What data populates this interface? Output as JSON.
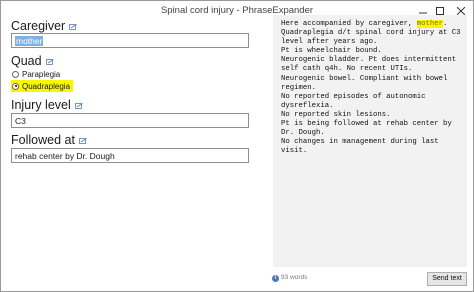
{
  "window": {
    "title": "Spinal cord injury - PhraseExpander"
  },
  "form": {
    "caregiver": {
      "label": "Caregiver",
      "value": "mother"
    },
    "quad": {
      "label": "Quad",
      "options": [
        "Paraplegia",
        "Quadraplegia"
      ],
      "selected": "Quadraplegia"
    },
    "injury_level": {
      "label": "Injury level",
      "value": "C3"
    },
    "followed_at": {
      "label": "Followed at",
      "value": "rehab center by Dr. Dough"
    }
  },
  "preview": {
    "line1_prefix": "Here accompanied by caregiver, ",
    "line1_highlight": "mother",
    "line1_suffix": ".",
    "body": "Quadraplegia d/t spinal cord injury at C3\nlevel after years ago.\nPt is wheelchair bound.\nNeurogenic bladder. Pt does intermittent\nself cath q4h. No recent UTIs.\nNeurogenic bowel. Compliant with bowel\nregimen.\nNo reported episodes of autonomic\ndysreflexia.\nNo reported skin lesions.\nPt is being followed at rehab center by\nDr. Dough.\nNo changes in management during last\nvisit."
  },
  "footer": {
    "word_count": "93 words",
    "send_label": "Send text"
  },
  "colors": {
    "highlight": "#f7f700",
    "selection": "#7fb0e0",
    "info": "#4a79b5"
  }
}
